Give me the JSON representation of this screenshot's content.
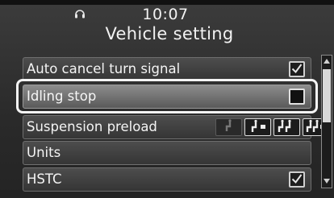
{
  "status": {
    "time": "10:07",
    "left_icon": "headset-icon"
  },
  "screen": {
    "title": "Vehicle setting"
  },
  "rows": [
    {
      "label": "Auto cancel turn signal",
      "control": "checkbox",
      "checked": true
    },
    {
      "label": "Idling stop",
      "control": "checkbox",
      "checked": false,
      "selected": true
    },
    {
      "label": "Suspension preload",
      "control": "preload-selector",
      "options": [
        "rider-icon",
        "rider-luggage-icon",
        "rider-passenger-icon",
        "rider-passenger-luggage-icon"
      ],
      "active_option": 3
    },
    {
      "label": "Units",
      "control": "none"
    },
    {
      "label": "HSTC",
      "control": "checkbox",
      "checked": true
    }
  ],
  "colors": {
    "selection_ring": "#f4f4f4",
    "row_background": "#404040",
    "screen_background": "#2e2e2e"
  }
}
